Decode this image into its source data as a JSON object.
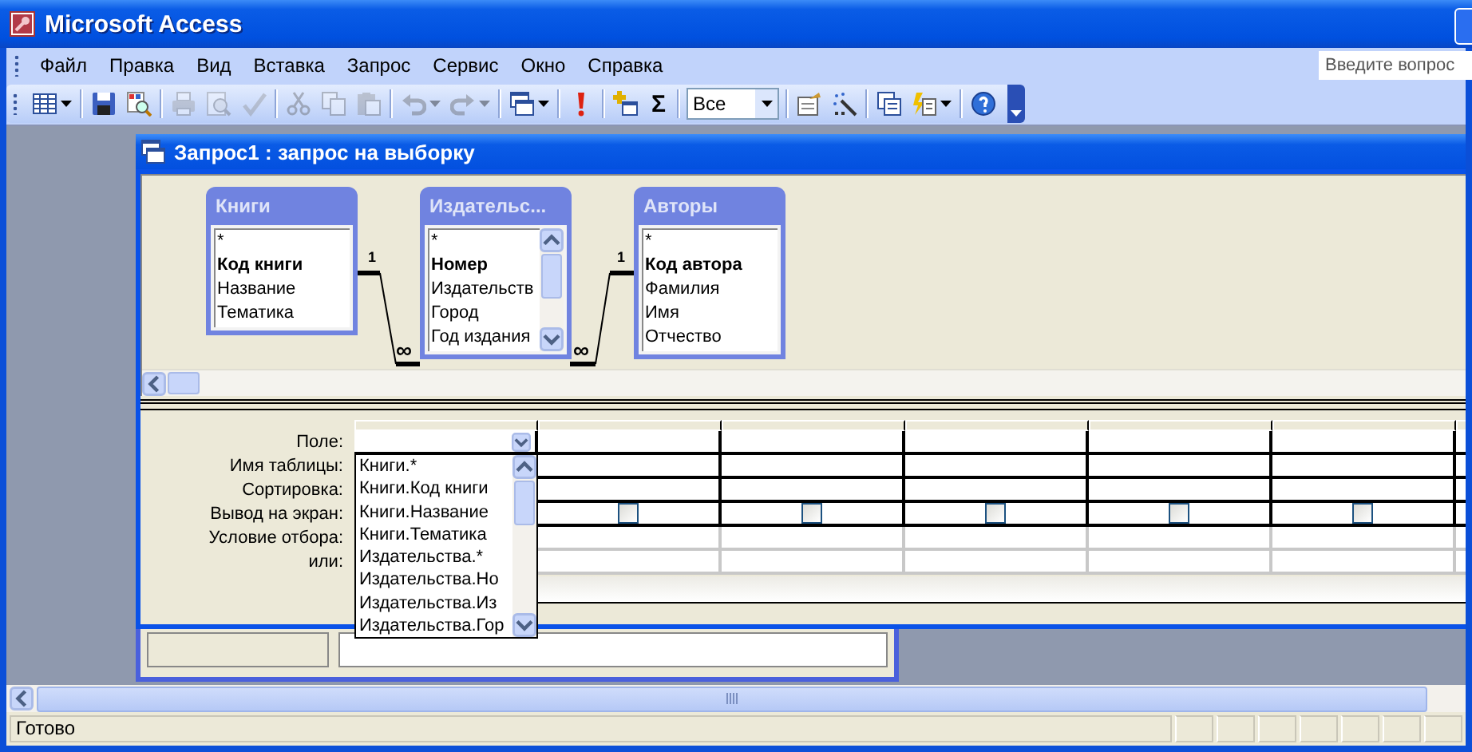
{
  "window": {
    "title": "Microsoft Access"
  },
  "menu": [
    {
      "label": "Файл"
    },
    {
      "label": "Правка"
    },
    {
      "label": "Вид"
    },
    {
      "label": "Вставка"
    },
    {
      "label": "Запрос"
    },
    {
      "label": "Сервис"
    },
    {
      "label": "Окно"
    },
    {
      "label": "Справка"
    }
  ],
  "help_box": {
    "placeholder": "Введите вопрос"
  },
  "toolbar": [
    {
      "kind": "datasheet",
      "dropdown": true,
      "disabled": false
    },
    {
      "kind": "separator"
    },
    {
      "kind": "save",
      "dropdown": false,
      "disabled": false
    },
    {
      "kind": "search_doc",
      "dropdown": false,
      "disabled": false
    },
    {
      "kind": "separator"
    },
    {
      "kind": "print",
      "dropdown": false,
      "disabled": true
    },
    {
      "kind": "preview",
      "dropdown": false,
      "disabled": true
    },
    {
      "kind": "spell",
      "dropdown": false,
      "disabled": true
    },
    {
      "kind": "separator"
    },
    {
      "kind": "cut",
      "dropdown": false,
      "disabled": true
    },
    {
      "kind": "copy",
      "dropdown": false,
      "disabled": true
    },
    {
      "kind": "paste",
      "dropdown": false,
      "disabled": true
    },
    {
      "kind": "separator"
    },
    {
      "kind": "undo",
      "dropdown": true,
      "disabled": true
    },
    {
      "kind": "redo",
      "dropdown": true,
      "disabled": true
    },
    {
      "kind": "separator"
    },
    {
      "kind": "windows",
      "dropdown": true,
      "disabled": false
    },
    {
      "kind": "separator"
    },
    {
      "kind": "run",
      "dropdown": false,
      "disabled": false
    },
    {
      "kind": "separator"
    },
    {
      "kind": "add_table",
      "dropdown": false,
      "disabled": false
    },
    {
      "kind": "text",
      "label": "Σ",
      "disabled": false
    },
    {
      "kind": "separator"
    },
    {
      "kind": "combo",
      "value": "Все"
    },
    {
      "kind": "separator"
    },
    {
      "kind": "properties",
      "dropdown": false,
      "disabled": false
    },
    {
      "kind": "builder",
      "dropdown": false,
      "disabled": false
    },
    {
      "kind": "separator"
    },
    {
      "kind": "db_window",
      "dropdown": false,
      "disabled": false
    },
    {
      "kind": "new_object",
      "dropdown": true,
      "disabled": false
    },
    {
      "kind": "separator"
    },
    {
      "kind": "help",
      "dropdown": false,
      "disabled": false
    }
  ],
  "query_window": {
    "title": "Запрос1 : запрос на выборку",
    "tables": [
      {
        "title": "Книги",
        "scrollbar": false,
        "fields": [
          {
            "name": "*",
            "key": false
          },
          {
            "name": "Код книги",
            "key": true
          },
          {
            "name": "Название",
            "key": false
          },
          {
            "name": "Тематика",
            "key": false
          }
        ]
      },
      {
        "title": "Издательс...",
        "scrollbar": true,
        "fields": [
          {
            "name": "*",
            "key": false
          },
          {
            "name": "Номер",
            "key": true
          },
          {
            "name": "Издательств",
            "key": false
          },
          {
            "name": "Город",
            "key": false
          },
          {
            "name": "Год издания",
            "key": false
          }
        ]
      },
      {
        "title": "Авторы",
        "scrollbar": false,
        "fields": [
          {
            "name": "*",
            "key": false
          },
          {
            "name": "Код автора",
            "key": true
          },
          {
            "name": "Фамилия",
            "key": false
          },
          {
            "name": "Имя",
            "key": false
          },
          {
            "name": "Отчество",
            "key": false
          }
        ]
      }
    ],
    "relations": [
      {
        "one": "1",
        "many": "∞"
      },
      {
        "one": "1",
        "many": "∞"
      }
    ],
    "grid": {
      "row_labels": [
        "Поле:",
        "Имя таблицы:",
        "Сортировка:",
        "Вывод на экран:",
        "Условие отбора:",
        "или:"
      ],
      "columns": [
        {
          "kind": "active"
        },
        {
          "kind": "plain",
          "checked": false
        },
        {
          "kind": "plain",
          "checked": false
        },
        {
          "kind": "plain",
          "checked": false
        },
        {
          "kind": "plain",
          "checked": false
        },
        {
          "kind": "plain",
          "checked": false
        },
        {
          "kind": "plain"
        }
      ]
    },
    "field_dropdown": {
      "options": [
        "Книги.*",
        "Книги.Код книги",
        "Книги.Название",
        "Книги.Тематика",
        "Издательства.*",
        "Издательства.Но",
        "Издательства.Из",
        "Издательства.Гор"
      ]
    }
  },
  "status_bar": {
    "text": "Готово"
  }
}
